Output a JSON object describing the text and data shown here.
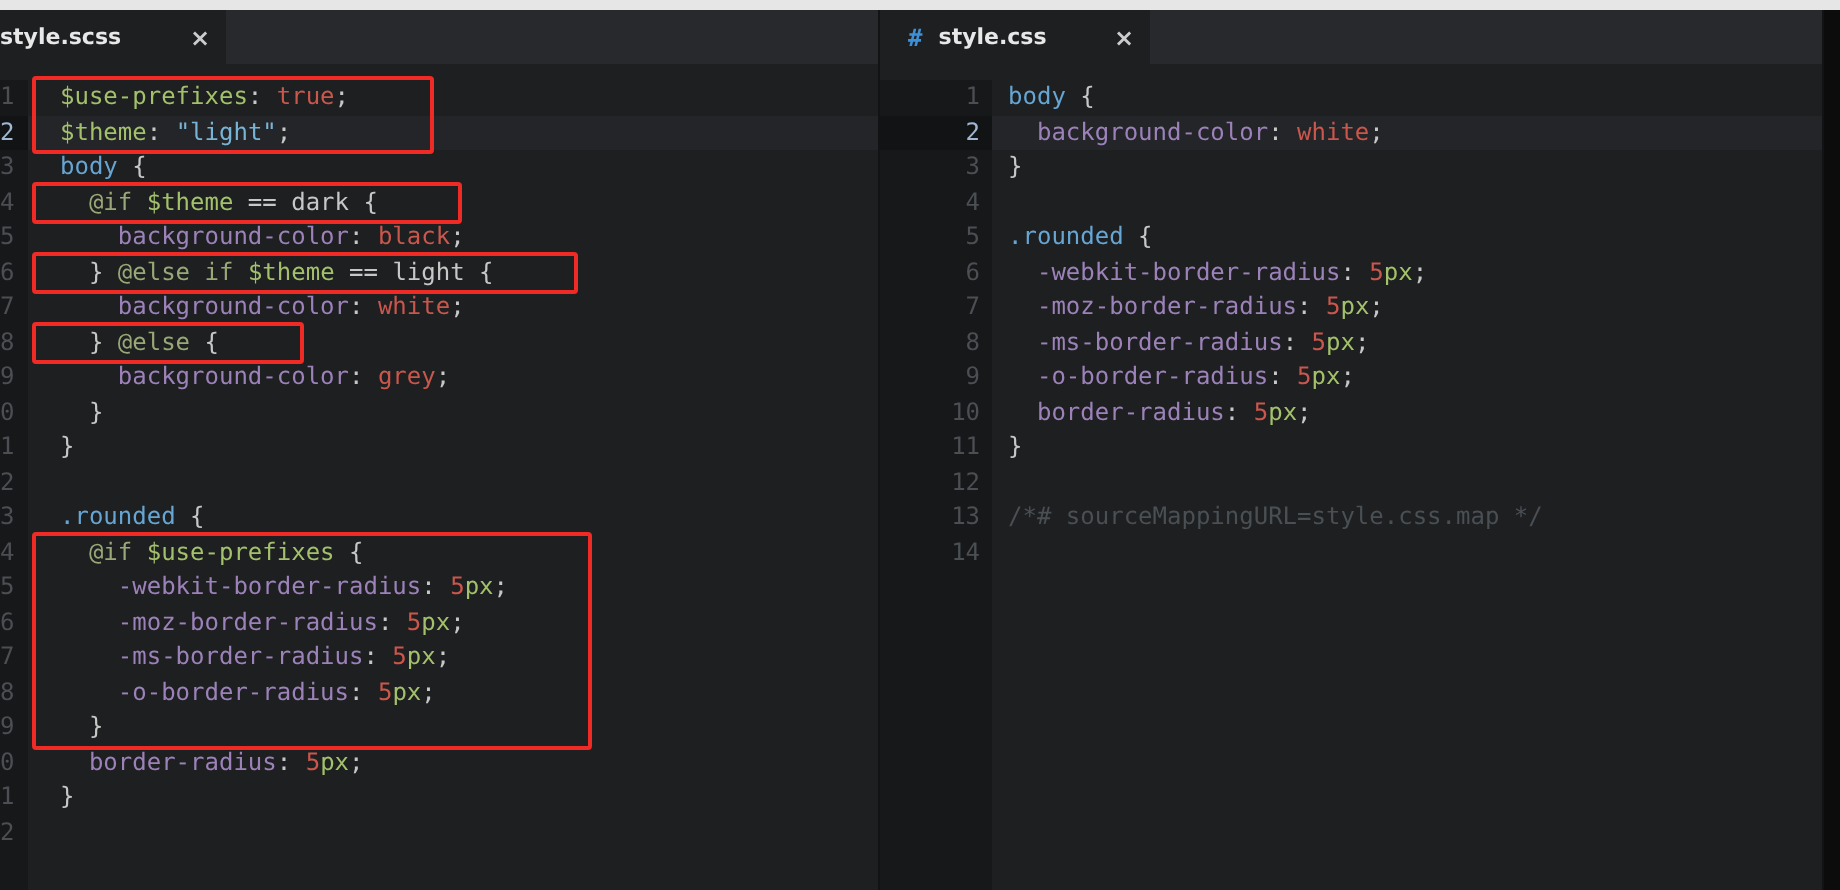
{
  "panes": [
    {
      "tab": {
        "label": "style.scss",
        "close": "×",
        "selected": true
      },
      "groups": [
        {
          "boxed": true,
          "lines": [
            {
              "n": "1",
              "current": false,
              "tokens": [
                {
                  "kind": "var",
                  "text": "$use-prefixes"
                },
                {
                  "kind": "punct",
                  "text": ":"
                },
                {
                  "kind": "value",
                  "text": " true"
                },
                {
                  "kind": "punct",
                  "text": ";"
                }
              ]
            },
            {
              "n": "2",
              "current": true,
              "tokens": [
                {
                  "kind": "var",
                  "text": "$theme"
                },
                {
                  "kind": "punct",
                  "text": ":"
                },
                {
                  "kind": "string",
                  "text": " \"light\""
                },
                {
                  "kind": "punct",
                  "text": ";"
                }
              ]
            }
          ]
        },
        {
          "boxed": false,
          "lines": [
            {
              "n": "3",
              "current": false,
              "tokens": [
                {
                  "kind": "selector",
                  "text": "body"
                },
                {
                  "kind": "punct",
                  "text": " {"
                }
              ]
            }
          ]
        },
        {
          "boxed": true,
          "lines": [
            {
              "n": "4",
              "current": false,
              "tokens": [
                {
                  "kind": "keyword",
                  "text": "  @if"
                },
                {
                  "kind": "var",
                  "text": " $theme"
                },
                {
                  "kind": "punct",
                  "text": " == dark {"
                }
              ]
            }
          ]
        },
        {
          "boxed": false,
          "lines": [
            {
              "n": "5",
              "current": false,
              "tokens": [
                {
                  "kind": "prop",
                  "text": "    background-color"
                },
                {
                  "kind": "punct",
                  "text": ":"
                },
                {
                  "kind": "value",
                  "text": " black"
                },
                {
                  "kind": "punct",
                  "text": ";"
                }
              ]
            }
          ]
        },
        {
          "boxed": true,
          "lines": [
            {
              "n": "6",
              "current": false,
              "tokens": [
                {
                  "kind": "punct",
                  "text": "  }"
                },
                {
                  "kind": "keyword",
                  "text": " @else if"
                },
                {
                  "kind": "var",
                  "text": " $theme"
                },
                {
                  "kind": "punct",
                  "text": " == light {"
                }
              ]
            }
          ]
        },
        {
          "boxed": false,
          "lines": [
            {
              "n": "7",
              "current": false,
              "tokens": [
                {
                  "kind": "prop",
                  "text": "    background-color"
                },
                {
                  "kind": "punct",
                  "text": ":"
                },
                {
                  "kind": "value",
                  "text": " white"
                },
                {
                  "kind": "punct",
                  "text": ";"
                }
              ]
            }
          ]
        },
        {
          "boxed": true,
          "lines": [
            {
              "n": "8",
              "current": false,
              "tokens": [
                {
                  "kind": "punct",
                  "text": "  }"
                },
                {
                  "kind": "keyword",
                  "text": " @else"
                },
                {
                  "kind": "punct",
                  "text": " {"
                }
              ]
            }
          ]
        },
        {
          "boxed": false,
          "lines": [
            {
              "n": "9",
              "current": false,
              "tokens": [
                {
                  "kind": "prop",
                  "text": "    background-color"
                },
                {
                  "kind": "punct",
                  "text": ":"
                },
                {
                  "kind": "value",
                  "text": " grey"
                },
                {
                  "kind": "punct",
                  "text": ";"
                }
              ]
            },
            {
              "n": "0",
              "current": false,
              "tokens": [
                {
                  "kind": "punct",
                  "text": "  }"
                }
              ]
            },
            {
              "n": "1",
              "current": false,
              "tokens": [
                {
                  "kind": "punct",
                  "text": "}"
                }
              ]
            },
            {
              "n": "2",
              "current": false
            },
            {
              "n": "3",
              "current": false,
              "tokens": [
                {
                  "kind": "selector",
                  "text": ".rounded"
                },
                {
                  "kind": "punct",
                  "text": " {"
                }
              ]
            }
          ]
        },
        {
          "boxed": true,
          "lines": [
            {
              "n": "4",
              "current": false,
              "tokens": [
                {
                  "kind": "keyword",
                  "text": "  @if"
                },
                {
                  "kind": "var",
                  "text": " $use-prefixes"
                },
                {
                  "kind": "punct",
                  "text": " {"
                }
              ]
            },
            {
              "n": "5",
              "current": false,
              "tokens": [
                {
                  "kind": "prop",
                  "text": "    -webkit-border-radius"
                },
                {
                  "kind": "punct",
                  "text": ":"
                },
                {
                  "kind": "value",
                  "text": " 5"
                },
                {
                  "kind": "unit",
                  "text": "px"
                },
                {
                  "kind": "punct",
                  "text": ";"
                }
              ]
            },
            {
              "n": "6",
              "current": false,
              "tokens": [
                {
                  "kind": "prop",
                  "text": "    -moz-border-radius"
                },
                {
                  "kind": "punct",
                  "text": ":"
                },
                {
                  "kind": "value",
                  "text": " 5"
                },
                {
                  "kind": "unit",
                  "text": "px"
                },
                {
                  "kind": "punct",
                  "text": ";"
                }
              ]
            },
            {
              "n": "7",
              "current": false,
              "tokens": [
                {
                  "kind": "prop",
                  "text": "    -ms-border-radius"
                },
                {
                  "kind": "punct",
                  "text": ":"
                },
                {
                  "kind": "value",
                  "text": " 5"
                },
                {
                  "kind": "unit",
                  "text": "px"
                },
                {
                  "kind": "punct",
                  "text": ";"
                }
              ]
            },
            {
              "n": "8",
              "current": false,
              "tokens": [
                {
                  "kind": "prop",
                  "text": "    -o-border-radius"
                },
                {
                  "kind": "punct",
                  "text": ":"
                },
                {
                  "kind": "value",
                  "text": " 5"
                },
                {
                  "kind": "unit",
                  "text": "px"
                },
                {
                  "kind": "punct",
                  "text": ";"
                }
              ]
            },
            {
              "n": "9",
              "current": false,
              "tokens": [
                {
                  "kind": "punct",
                  "text": "  }"
                }
              ]
            }
          ]
        },
        {
          "boxed": false,
          "lines": [
            {
              "n": "0",
              "current": false,
              "tokens": [
                {
                  "kind": "prop",
                  "text": "  border-radius"
                },
                {
                  "kind": "punct",
                  "text": ":"
                },
                {
                  "kind": "value",
                  "text": " 5"
                },
                {
                  "kind": "unit",
                  "text": "px"
                },
                {
                  "kind": "punct",
                  "text": ";"
                }
              ]
            },
            {
              "n": "1",
              "current": false,
              "tokens": [
                {
                  "kind": "punct",
                  "text": "}"
                }
              ]
            },
            {
              "n": "2",
              "current": false
            }
          ]
        }
      ]
    },
    {
      "tab": {
        "icon": "#",
        "label": "style.css",
        "close": "×",
        "selected": true
      },
      "groups": [
        {
          "boxed": false,
          "lines": [
            {
              "n": "1",
              "current": false,
              "tokens": [
                {
                  "kind": "selector",
                  "text": "body"
                },
                {
                  "kind": "punct",
                  "text": " {"
                }
              ]
            },
            {
              "n": "2",
              "current": true,
              "tokens": [
                {
                  "kind": "prop",
                  "text": "  background-color"
                },
                {
                  "kind": "punct",
                  "text": ":"
                },
                {
                  "kind": "value",
                  "text": " white"
                },
                {
                  "kind": "punct",
                  "text": ";"
                }
              ]
            },
            {
              "n": "3",
              "current": false,
              "tokens": [
                {
                  "kind": "punct",
                  "text": "}"
                }
              ]
            },
            {
              "n": "4",
              "current": false
            },
            {
              "n": "5",
              "current": false,
              "tokens": [
                {
                  "kind": "selector",
                  "text": ".rounded"
                },
                {
                  "kind": "punct",
                  "text": " {"
                }
              ]
            },
            {
              "n": "6",
              "current": false,
              "tokens": [
                {
                  "kind": "prop",
                  "text": "  -webkit-border-radius"
                },
                {
                  "kind": "punct",
                  "text": ":"
                },
                {
                  "kind": "value",
                  "text": " 5"
                },
                {
                  "kind": "unit",
                  "text": "px"
                },
                {
                  "kind": "punct",
                  "text": ";"
                }
              ]
            },
            {
              "n": "7",
              "current": false,
              "tokens": [
                {
                  "kind": "prop",
                  "text": "  -moz-border-radius"
                },
                {
                  "kind": "punct",
                  "text": ":"
                },
                {
                  "kind": "value",
                  "text": " 5"
                },
                {
                  "kind": "unit",
                  "text": "px"
                },
                {
                  "kind": "punct",
                  "text": ";"
                }
              ]
            },
            {
              "n": "8",
              "current": false,
              "tokens": [
                {
                  "kind": "prop",
                  "text": "  -ms-border-radius"
                },
                {
                  "kind": "punct",
                  "text": ":"
                },
                {
                  "kind": "value",
                  "text": " 5"
                },
                {
                  "kind": "unit",
                  "text": "px"
                },
                {
                  "kind": "punct",
                  "text": ";"
                }
              ]
            },
            {
              "n": "9",
              "current": false,
              "tokens": [
                {
                  "kind": "prop",
                  "text": "  -o-border-radius"
                },
                {
                  "kind": "punct",
                  "text": ":"
                },
                {
                  "kind": "value",
                  "text": " 5"
                },
                {
                  "kind": "unit",
                  "text": "px"
                },
                {
                  "kind": "punct",
                  "text": ";"
                }
              ]
            },
            {
              "n": "10",
              "current": false,
              "tokens": [
                {
                  "kind": "prop",
                  "text": "  border-radius"
                },
                {
                  "kind": "punct",
                  "text": ":"
                },
                {
                  "kind": "value",
                  "text": " 5"
                },
                {
                  "kind": "unit",
                  "text": "px"
                },
                {
                  "kind": "punct",
                  "text": ";"
                }
              ]
            },
            {
              "n": "11",
              "current": false,
              "tokens": [
                {
                  "kind": "punct",
                  "text": "}"
                }
              ]
            },
            {
              "n": "12",
              "current": false
            },
            {
              "n": "13",
              "current": false,
              "tokens": [
                {
                  "kind": "comment",
                  "text": "/*# sourceMappingURL=style.css.map */"
                }
              ]
            },
            {
              "n": "14",
              "current": false
            }
          ]
        }
      ]
    }
  ]
}
